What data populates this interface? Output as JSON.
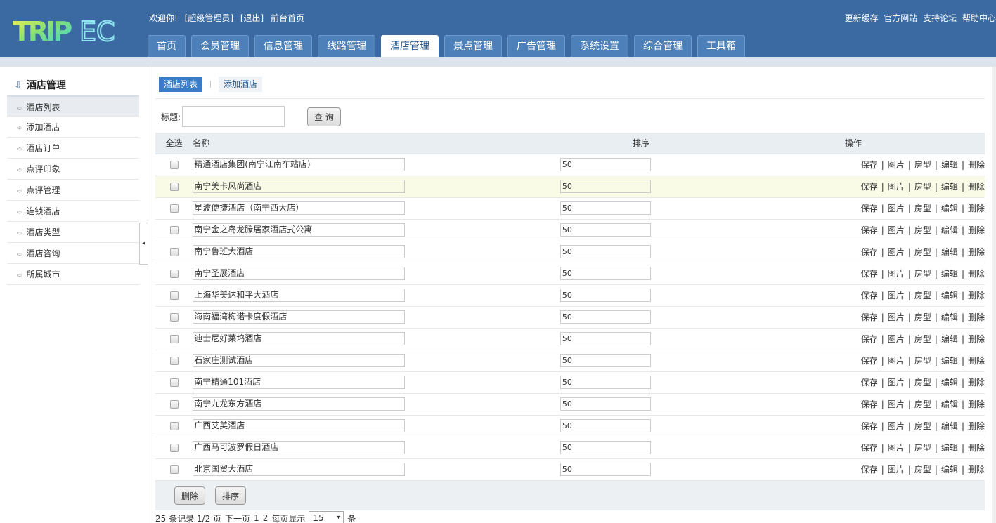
{
  "header": {
    "logo_text": "TRIPEC",
    "welcome": [
      "欢迎你!",
      "[超级管理员]",
      "[退出]",
      "前台首页"
    ],
    "top_links": [
      "更新缓存",
      "官方网站",
      "支持论坛",
      "帮助中心"
    ],
    "nav_tabs": [
      "首页",
      "会员管理",
      "信息管理",
      "线路管理",
      "酒店管理",
      "景点管理",
      "广告管理",
      "系统设置",
      "综合管理",
      "工具箱"
    ],
    "active_tab": "酒店管理"
  },
  "sidebar": {
    "title": "酒店管理",
    "items": [
      "酒店列表",
      "添加酒店",
      "酒店订单",
      "点评印象",
      "点评管理",
      "连锁酒店",
      "酒店类型",
      "酒店咨询",
      "所属城市"
    ],
    "collapse_glyph": "◂"
  },
  "main": {
    "subtabs": [
      "酒店列表",
      "添加酒店"
    ],
    "search": {
      "label": "标题:",
      "placeholder": "",
      "button": "查 询"
    },
    "table": {
      "headers": {
        "check": "全选",
        "name": "名称",
        "order": "排序",
        "ops": "操作"
      },
      "ops": [
        "保存",
        "图片",
        "房型",
        "编辑",
        "删除"
      ],
      "rows": [
        {
          "name": "精通酒店集团(南宁江南车站店)",
          "order": "50"
        },
        {
          "name": "南宁美卡风尚酒店",
          "order": "50"
        },
        {
          "name": "星波便捷酒店（南宁西大店）",
          "order": "50"
        },
        {
          "name": "南宁金之岛龙滕居家酒店式公寓",
          "order": "50"
        },
        {
          "name": "南宁鲁班大酒店",
          "order": "50"
        },
        {
          "name": "南宁圣展酒店",
          "order": "50"
        },
        {
          "name": "上海华美达和平大酒店",
          "order": "50"
        },
        {
          "name": "海南福湾梅诺卡度假酒店",
          "order": "50"
        },
        {
          "name": "迪士尼好莱坞酒店",
          "order": "50"
        },
        {
          "name": "石家庄测试酒店",
          "order": "50"
        },
        {
          "name": "南宁精通101酒店",
          "order": "50"
        },
        {
          "name": "南宁九龙东方酒店",
          "order": "50"
        },
        {
          "name": "广西艾美酒店",
          "order": "50"
        },
        {
          "name": " 广西马可波罗假日酒店",
          "order": "50"
        },
        {
          "name": "北京国贸大酒店",
          "order": "50"
        }
      ]
    },
    "footer_buttons": [
      "删除",
      "排序"
    ],
    "pager": {
      "summary": "25 条记录 1/2 页",
      "next": "下一页",
      "pages": [
        "1",
        "2"
      ],
      "per_page_label": "每页显示",
      "per_page": "15",
      "unit": "条"
    }
  }
}
